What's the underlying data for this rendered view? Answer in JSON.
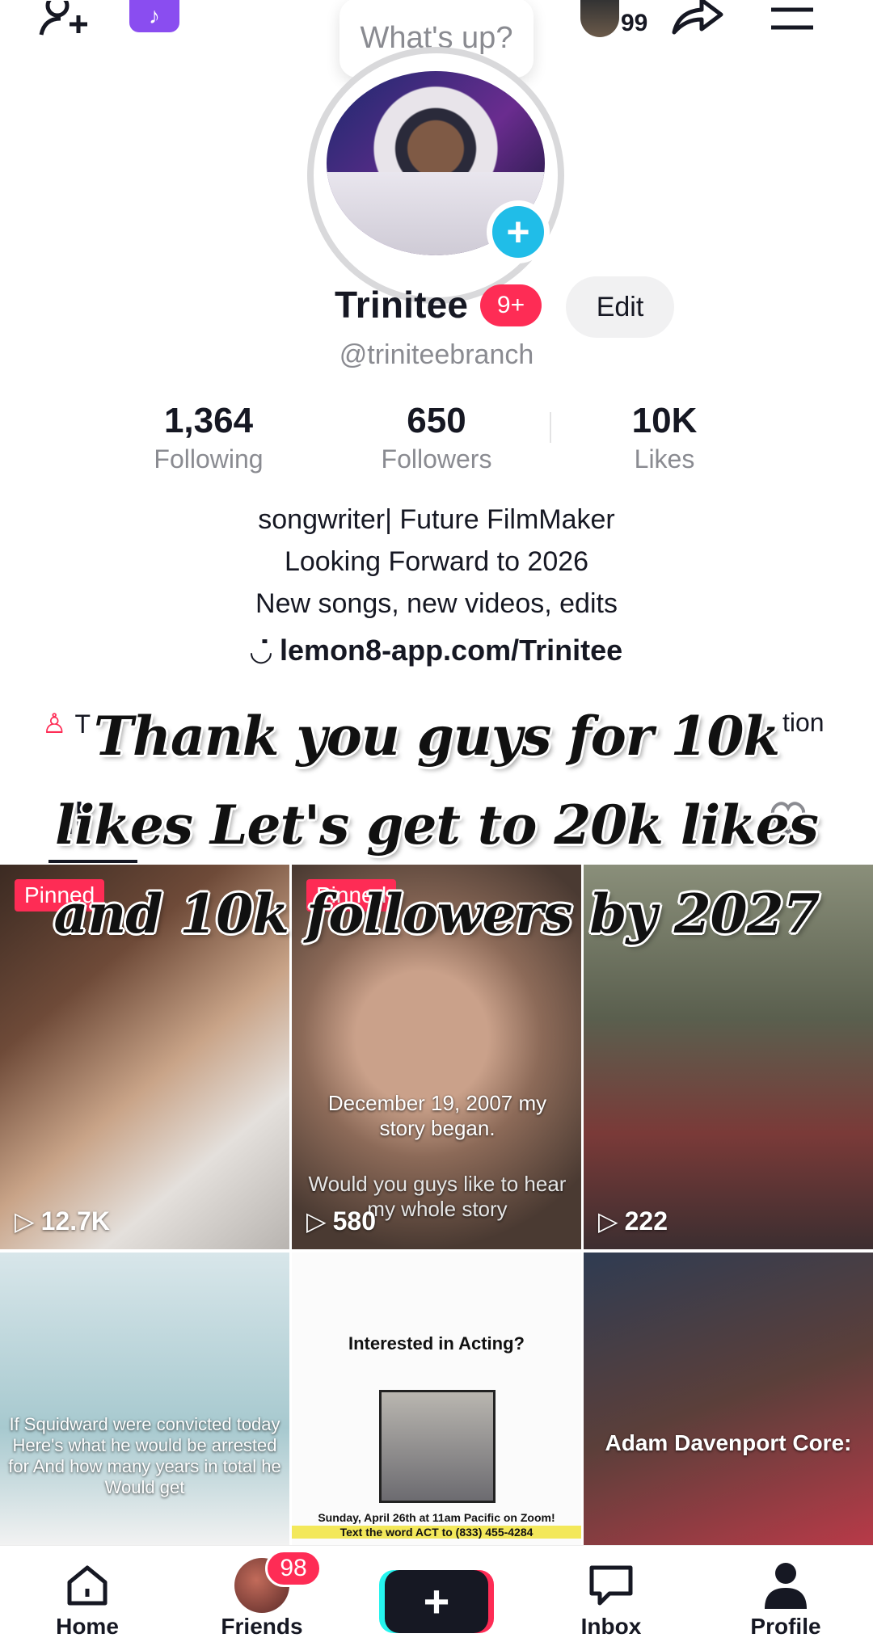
{
  "header": {
    "add_friend_icon": "add-person-icon",
    "tiktok_studio_icon": "tiktok-note-icon",
    "story_count": "99",
    "share_icon": "share-arrow-icon",
    "menu_icon": "hamburger-icon"
  },
  "note_bubble": "What's up?",
  "profile": {
    "name": "Trinitee",
    "notifications_badge": "9+",
    "edit_label": "Edit",
    "handle": "@triniteebranch"
  },
  "stats": [
    {
      "value": "1,364",
      "label": "Following"
    },
    {
      "value": "650",
      "label": "Followers"
    },
    {
      "value": "10K",
      "label": "Likes"
    }
  ],
  "bio": {
    "lines": [
      "songwriter| Future FilmMaker",
      "Looking Forward to 2026",
      "New songs, new videos, edits"
    ],
    "link": "lemon8-app.com/Trinitee"
  },
  "quick_links": {
    "first_visible": "T",
    "last_visible": "tion"
  },
  "overlay_caption": {
    "line1": "Thank you guys for 10k",
    "line2": "likes Let's get to 20k likes",
    "line3": "and 10k followers by 2027"
  },
  "videos": [
    {
      "pinned": "Pinned",
      "views": "12.7K",
      "caption": ""
    },
    {
      "pinned": "Pinned",
      "views": "580",
      "caption": "December 19, 2007 my story began.",
      "caption2": "Would you guys like to hear my whole story"
    },
    {
      "pinned": "",
      "views": "222",
      "caption": ""
    },
    {
      "caption": "If Squidward were convicted today Here's what he would be arrested for And how many years in total he Would get"
    },
    {
      "title": "Interested in Acting?",
      "footer": "Sunday, April 26th at 11am Pacific on Zoom!",
      "footer2": "Text the word ACT to (833) 455-4284"
    },
    {
      "caption": "Adam Davenport Core:"
    }
  ],
  "nav": {
    "home": "Home",
    "friends": "Friends",
    "friends_badge": "98",
    "inbox": "Inbox",
    "profile": "Profile"
  },
  "colors": {
    "accent": "#fe2c55",
    "badge_blue": "#20bde8"
  }
}
